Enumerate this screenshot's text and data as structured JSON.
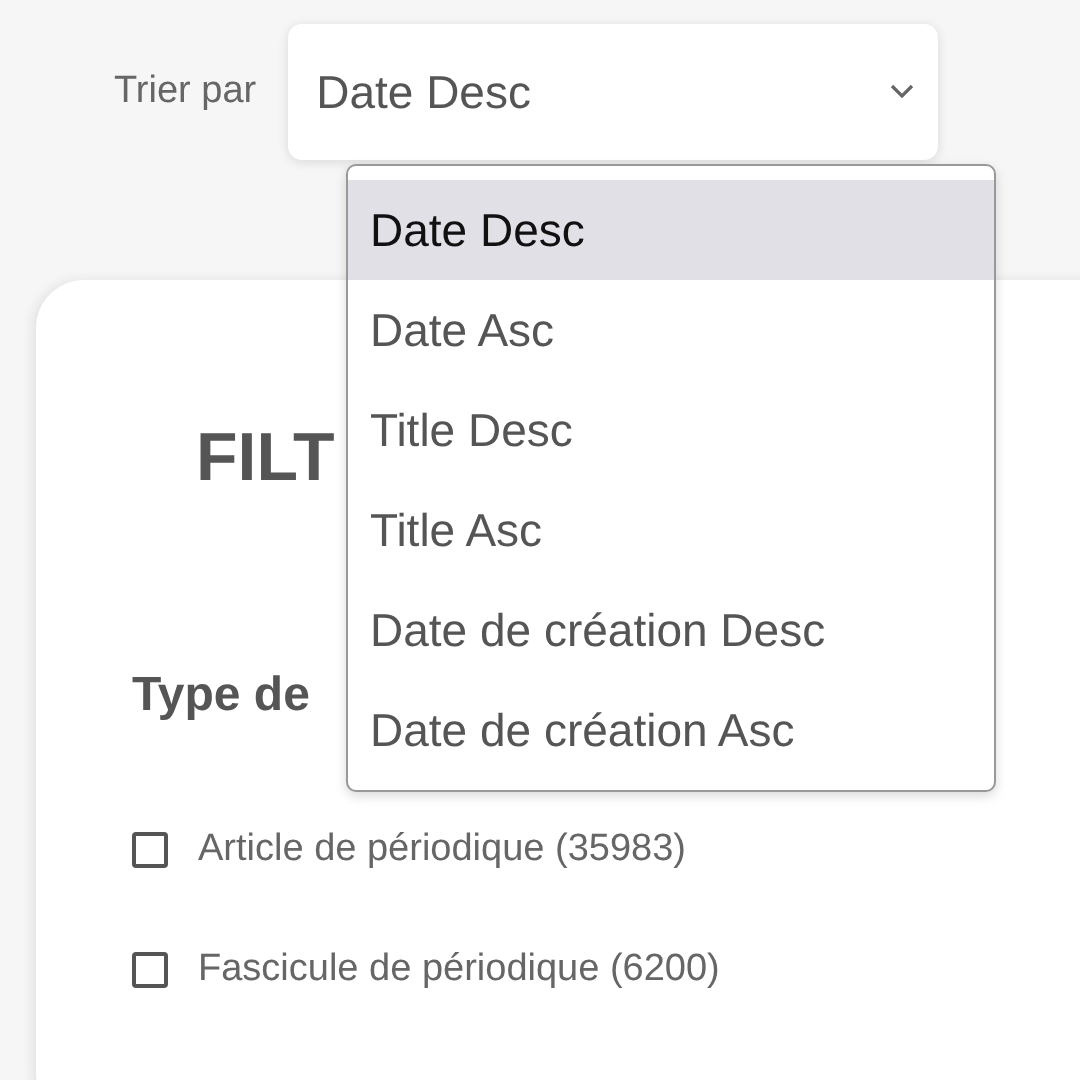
{
  "sort": {
    "label": "Trier par",
    "value": "Date Desc",
    "options": [
      {
        "label": "Date Desc",
        "selected": true
      },
      {
        "label": "Date Asc",
        "selected": false
      },
      {
        "label": "Title Desc",
        "selected": false
      },
      {
        "label": "Title Asc",
        "selected": false
      },
      {
        "label": "Date de création Desc",
        "selected": false
      },
      {
        "label": "Date de création Asc",
        "selected": false
      }
    ]
  },
  "filters": {
    "title": "FILT",
    "section_title": "Type de",
    "items": [
      {
        "label": "Article de périodique (35983)",
        "checked": false
      },
      {
        "label": "Fascicule de périodique (6200)",
        "checked": false
      }
    ]
  }
}
